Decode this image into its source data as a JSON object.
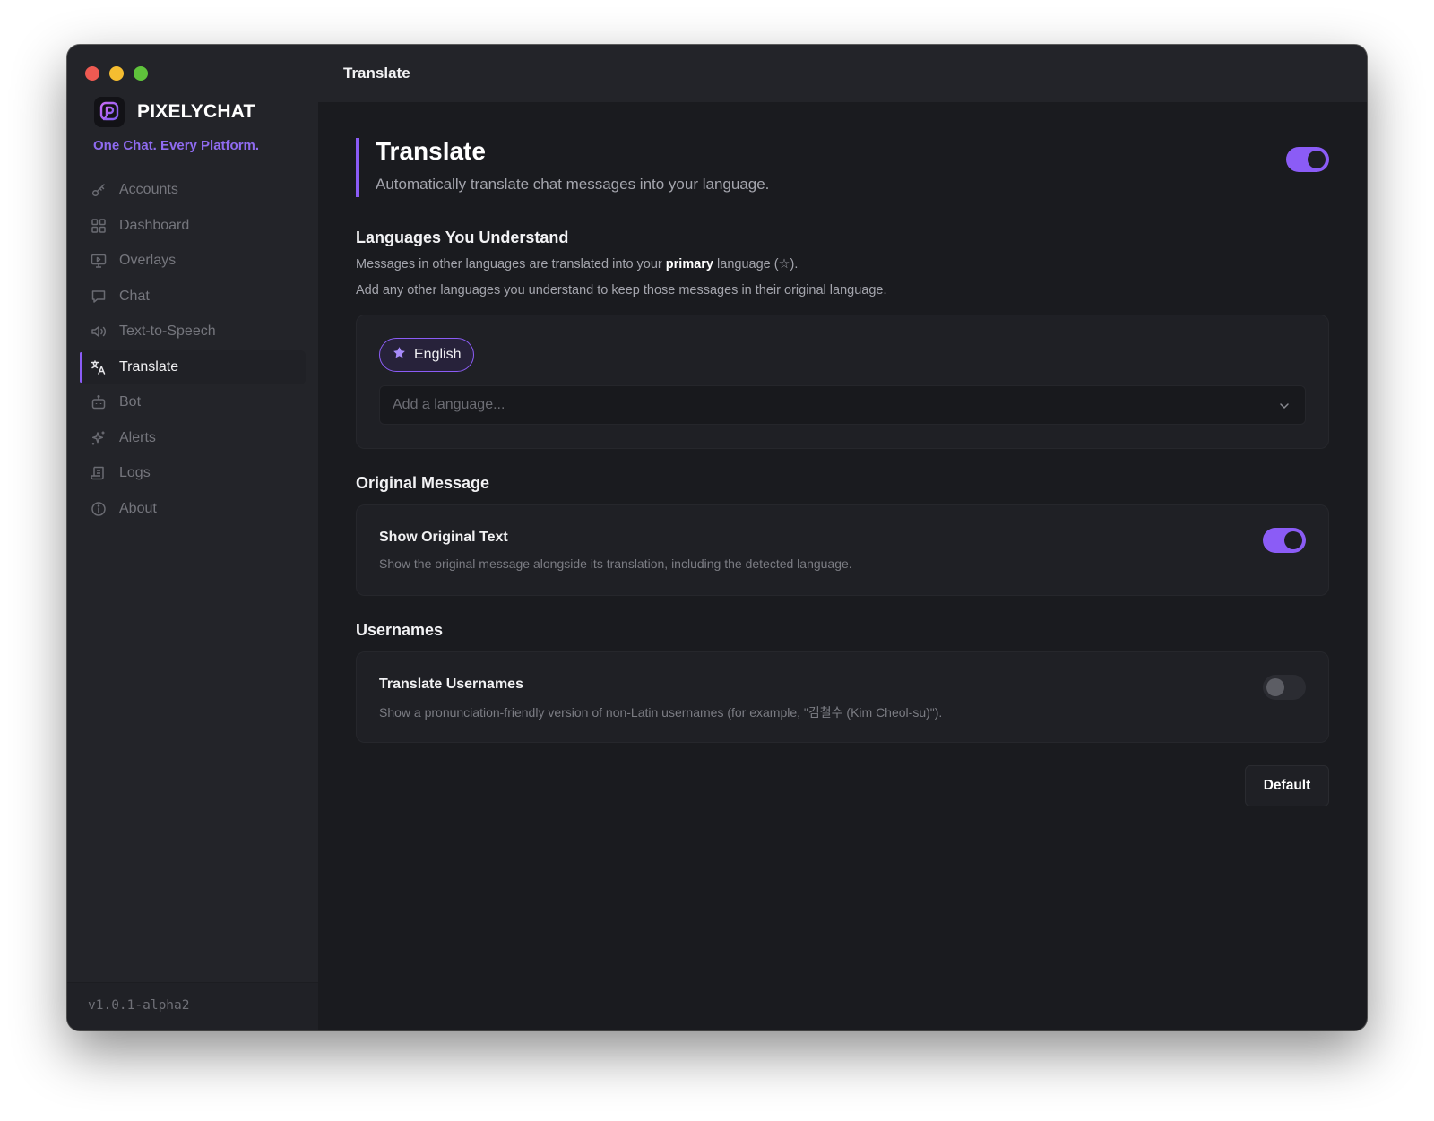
{
  "window": {
    "title": "Translate"
  },
  "sidebar": {
    "brand": "PIXELYCHAT",
    "tagline": "One Chat. Every Platform.",
    "items": [
      {
        "label": "Accounts",
        "icon": "key-icon"
      },
      {
        "label": "Dashboard",
        "icon": "grid-icon"
      },
      {
        "label": "Overlays",
        "icon": "monitor-icon"
      },
      {
        "label": "Chat",
        "icon": "chat-bubble-icon"
      },
      {
        "label": "Text-to-Speech",
        "icon": "speaker-icon"
      },
      {
        "label": "Translate",
        "icon": "translate-icon",
        "active": true
      },
      {
        "label": "Bot",
        "icon": "robot-icon"
      },
      {
        "label": "Alerts",
        "icon": "sparkle-icon"
      },
      {
        "label": "Logs",
        "icon": "scroll-icon"
      },
      {
        "label": "About",
        "icon": "info-icon"
      }
    ],
    "version": "v1.0.1-alpha2"
  },
  "page": {
    "title": "Translate",
    "subtitle": "Automatically translate chat messages into your language.",
    "enabled": true
  },
  "languages": {
    "title": "Languages You Understand",
    "desc1_pre": "Messages in other languages are translated into your ",
    "desc1_bold": "primary",
    "desc1_post": " language (☆).",
    "desc2": "Add any other languages you understand to keep those messages in their original language.",
    "chips": [
      {
        "label": "English",
        "primary": true
      }
    ],
    "add_placeholder": "Add a language..."
  },
  "original": {
    "section": "Original Message",
    "title": "Show Original Text",
    "desc": "Show the original message alongside its translation, including the detected language.",
    "enabled": true
  },
  "usernames": {
    "section": "Usernames",
    "title": "Translate Usernames",
    "desc": "Show a pronunciation-friendly version of non-Latin usernames (for example, \"김철수 (Kim Cheol-su)\").",
    "enabled": false
  },
  "actions": {
    "default_label": "Default"
  },
  "colors": {
    "accent": "#8b5cf6",
    "background": "#1a1b1f",
    "sidebar": "#232429",
    "card": "#1f2025"
  }
}
